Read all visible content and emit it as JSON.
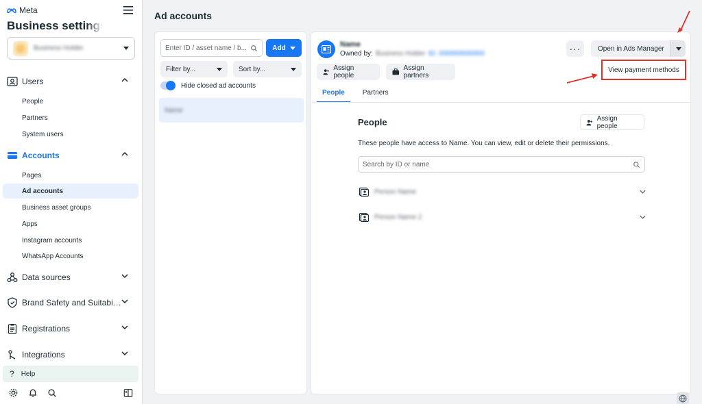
{
  "sidebar": {
    "brand": "Meta",
    "title": "Business settings",
    "business_name": "Business Holder",
    "sections": [
      {
        "label": "Users",
        "items": [
          "People",
          "Partners",
          "System users"
        ]
      },
      {
        "label": "Accounts",
        "items": [
          "Pages",
          "Ad accounts",
          "Business asset groups",
          "Apps",
          "Instagram accounts",
          "WhatsApp Accounts"
        ]
      },
      {
        "label": "Data sources"
      },
      {
        "label": "Brand Safety and Suitabi…"
      },
      {
        "label": "Registrations"
      },
      {
        "label": "Integrations"
      }
    ],
    "help": "Help"
  },
  "header": {
    "title": "Ad accounts"
  },
  "list": {
    "search_placeholder": "Enter ID / asset name / b...",
    "add_label": "Add",
    "filter_label": "Filter by...",
    "sort_label": "Sort by...",
    "toggle_label": "Hide closed ad accounts",
    "selected_item": "Name"
  },
  "detail": {
    "name": "Name",
    "owned_by_label": "Owned by:",
    "owner_name": "Business Holder",
    "owner_id": "ID: 000000000000",
    "open_ads_manager": "Open in Ads Manager",
    "assign_people": "Assign people",
    "assign_partners": "Assign partners",
    "view_payment": "View payment methods",
    "tabs": [
      "People",
      "Partners"
    ],
    "people_title": "People",
    "people_assign": "Assign people",
    "people_desc": "These people have access to Name. You can view, edit or delete their permissions.",
    "people_search_placeholder": "Search by ID or name",
    "people": [
      "Person Name",
      "Person Name 2"
    ]
  },
  "colors": {
    "accent": "#1877f2",
    "annotation": "#e1332a",
    "panel": "#ffffff",
    "background": "#f0f2f5"
  }
}
